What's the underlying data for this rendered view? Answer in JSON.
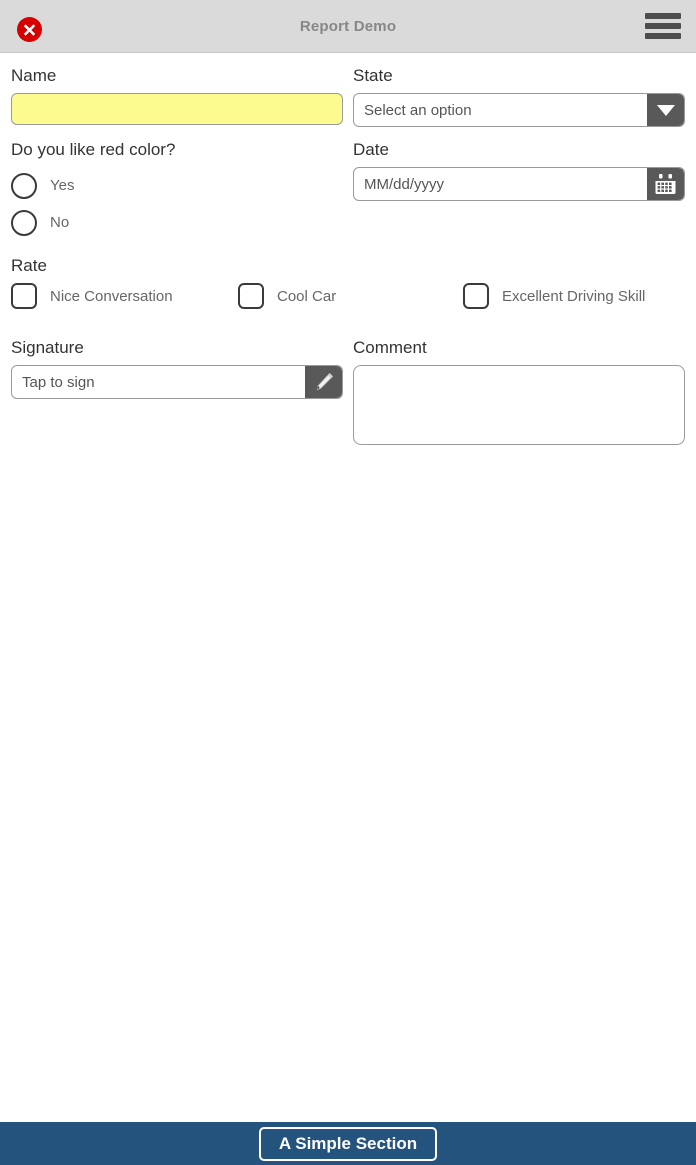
{
  "header": {
    "title": "Report Demo",
    "close_icon": "close-circle-icon",
    "menu_icon": "hamburger-menu-icon",
    "background_color": "#dadada",
    "title_color": "#878787",
    "close_color": "#d60000"
  },
  "form": {
    "name": {
      "label": "Name",
      "value": "",
      "placeholder": "",
      "background_color": "#fbfb90"
    },
    "state": {
      "label": "State",
      "value": "Select an option",
      "placeholder": "Select an option",
      "dropdown_icon": "chevron-down-icon",
      "options": [
        "Select an option"
      ]
    },
    "red_color_question": {
      "label": "Do you like red color?",
      "options": [
        {
          "label": "Yes",
          "selected": false
        },
        {
          "label": "No",
          "selected": false
        }
      ]
    },
    "date": {
      "label": "Date",
      "value": "",
      "placeholder": "MM/dd/yyyy",
      "calendar_icon": "calendar-icon"
    },
    "rate": {
      "label": "Rate",
      "options": [
        {
          "label": "Nice Conversation",
          "checked": false
        },
        {
          "label": "Cool Car",
          "checked": false
        },
        {
          "label": "Excellent Driving Skill",
          "checked": false
        }
      ]
    },
    "signature": {
      "label": "Signature",
      "value": "",
      "placeholder": "Tap to sign",
      "pencil_icon": "pencil-icon"
    },
    "comment": {
      "label": "Comment",
      "value": "",
      "placeholder": ""
    }
  },
  "footer": {
    "section_label": "A Simple Section",
    "background_color": "#24537d"
  }
}
